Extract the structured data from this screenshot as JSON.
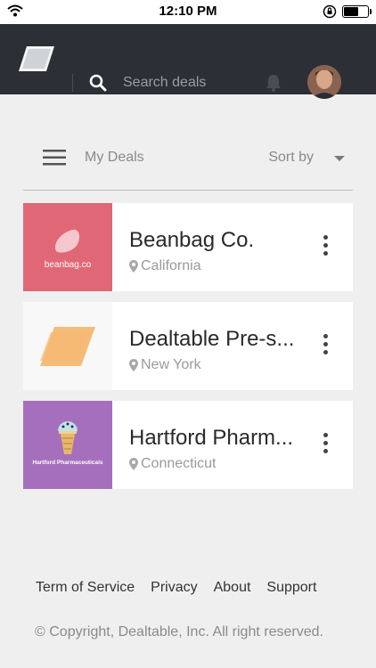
{
  "status": {
    "time": "12:10 PM"
  },
  "header": {
    "search_placeholder": "Search deals"
  },
  "toolbar": {
    "title": "My Deals",
    "sort_label": "Sort by"
  },
  "deals": [
    {
      "name": "Beanbag Co.",
      "location": "California",
      "logo_text": "beanbag.co",
      "color": "#e06876"
    },
    {
      "name": "Dealtable Pre-s...",
      "location": "New York",
      "color": "#f2a84e"
    },
    {
      "name": "Hartford Pharm...",
      "location": "Connecticut",
      "logo_text": "Hartford Pharmaceuticals",
      "color": "#a66fbd"
    }
  ],
  "footer": {
    "links": [
      "Term of Service",
      "Privacy",
      "About",
      "Support"
    ],
    "copyright": "© Copyright, Dealtable, Inc. All right reserved."
  }
}
